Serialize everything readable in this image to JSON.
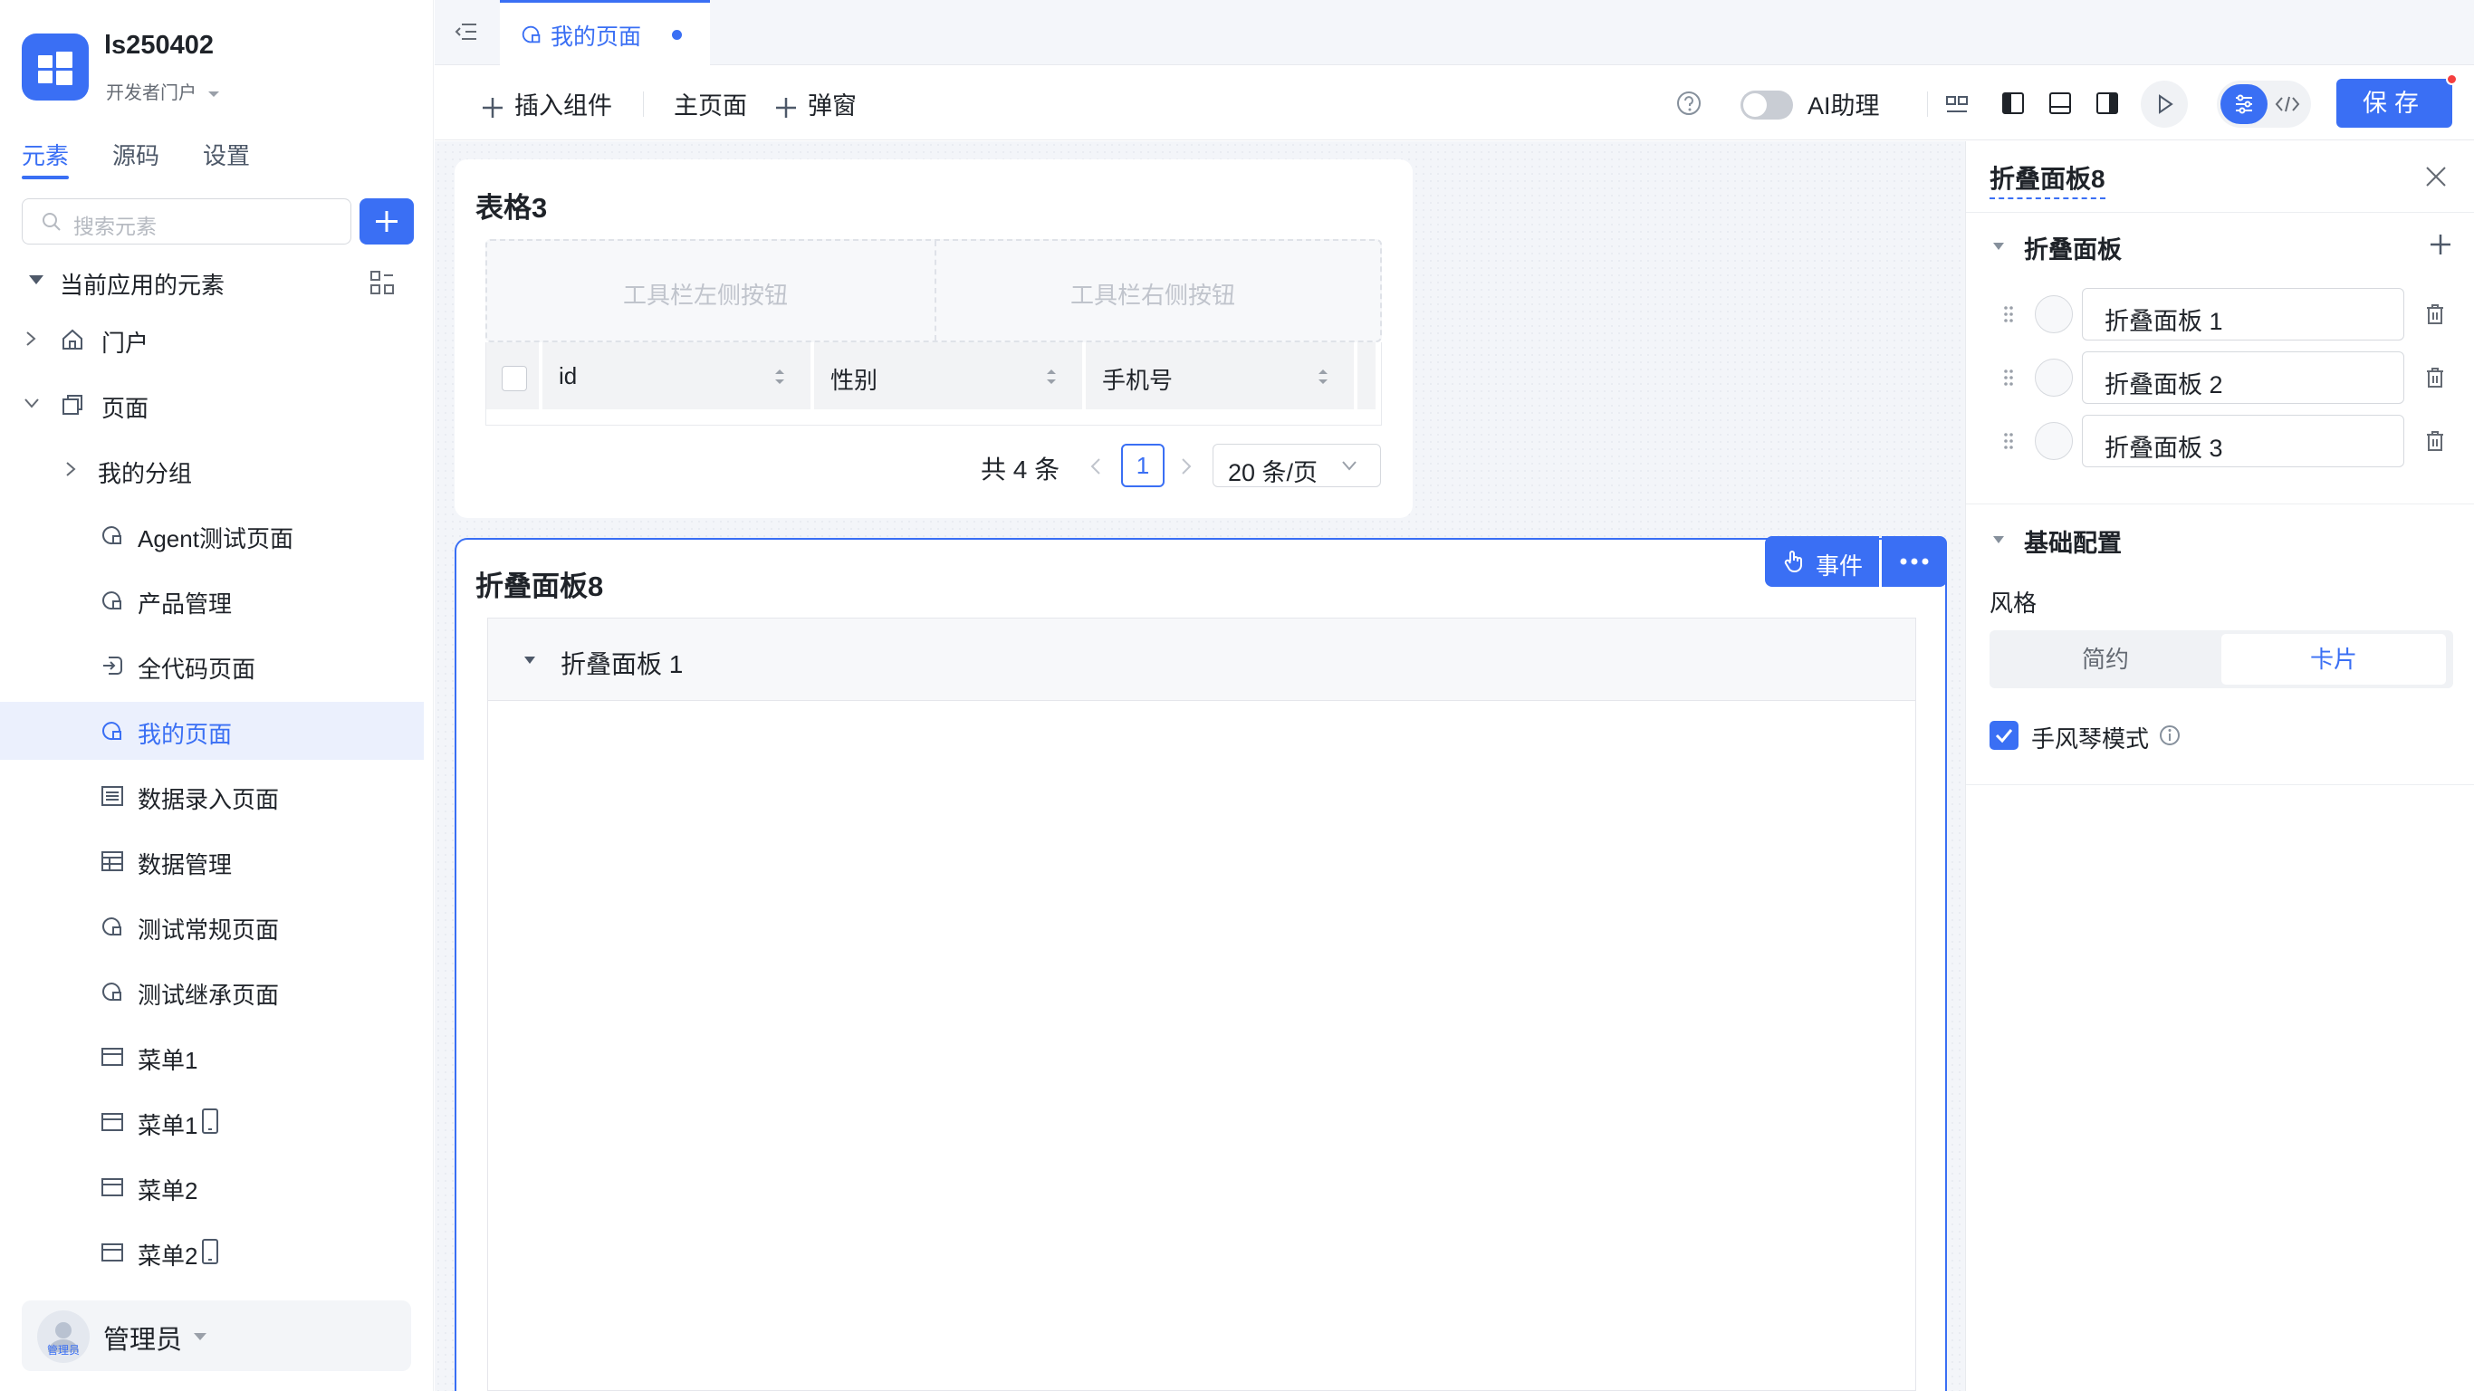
{
  "app": {
    "name": "ls250402",
    "subtitle": "开发者门户"
  },
  "sidebar": {
    "tabs": [
      "元素",
      "源码",
      "设置"
    ],
    "search_placeholder": "搜索元素",
    "section_title": "当前应用的元素",
    "tree": [
      {
        "label": "门户",
        "icon": "home-icon"
      },
      {
        "label": "页面",
        "icon": "pages-icon"
      },
      {
        "label": "我的分组",
        "icon": "folder-icon"
      },
      {
        "label": "Agent测试页面",
        "icon": "page-icon"
      },
      {
        "label": "产品管理",
        "icon": "page-icon"
      },
      {
        "label": "全代码页面",
        "icon": "code-page-icon"
      },
      {
        "label": "我的页面",
        "icon": "page-icon"
      },
      {
        "label": "数据录入页面",
        "icon": "form-icon"
      },
      {
        "label": "数据管理",
        "icon": "table-icon"
      },
      {
        "label": "测试常规页面",
        "icon": "page-icon"
      },
      {
        "label": "测试继承页面",
        "icon": "page-icon"
      },
      {
        "label": "菜单1",
        "icon": "menu-icon"
      },
      {
        "label": "菜单1",
        "icon": "menu-icon"
      },
      {
        "label": "菜单2",
        "icon": "menu-icon"
      },
      {
        "label": "菜单2",
        "icon": "menu-icon"
      }
    ],
    "user": {
      "name": "管理员",
      "avatar_text": "管理员"
    }
  },
  "tabbar": {
    "active_tab": "我的页面"
  },
  "toolbar": {
    "insert_component": "插入组件",
    "main_page": "主页面",
    "popup": "弹窗",
    "ai_assistant": "AI助理",
    "save": "保存"
  },
  "table_card": {
    "title": "表格3",
    "toolbar_left": "工具栏左侧按钮",
    "toolbar_right": "工具栏右侧按钮",
    "columns": [
      "id",
      "性别",
      "手机号"
    ],
    "pager": {
      "total": "共 4 条",
      "current_page": "1",
      "page_size": "20 条/页"
    }
  },
  "collapse_card": {
    "title": "折叠面板8",
    "event_button": "事件",
    "panel_title": "折叠面板 1"
  },
  "right_panel": {
    "title": "折叠面板8",
    "section_panels": "折叠面板",
    "items": [
      "折叠面板 1",
      "折叠面板 2",
      "折叠面板 3"
    ],
    "section_basic": "基础配置",
    "style_label": "风格",
    "style_options": [
      "简约",
      "卡片"
    ],
    "style_selected": "卡片",
    "accordion_label": "手风琴模式",
    "accordion_checked": true
  },
  "colors": {
    "accent": "#3a6ff4",
    "selected_bg": "#ebf0fd",
    "canvas_bg": "#f3f5f9"
  }
}
